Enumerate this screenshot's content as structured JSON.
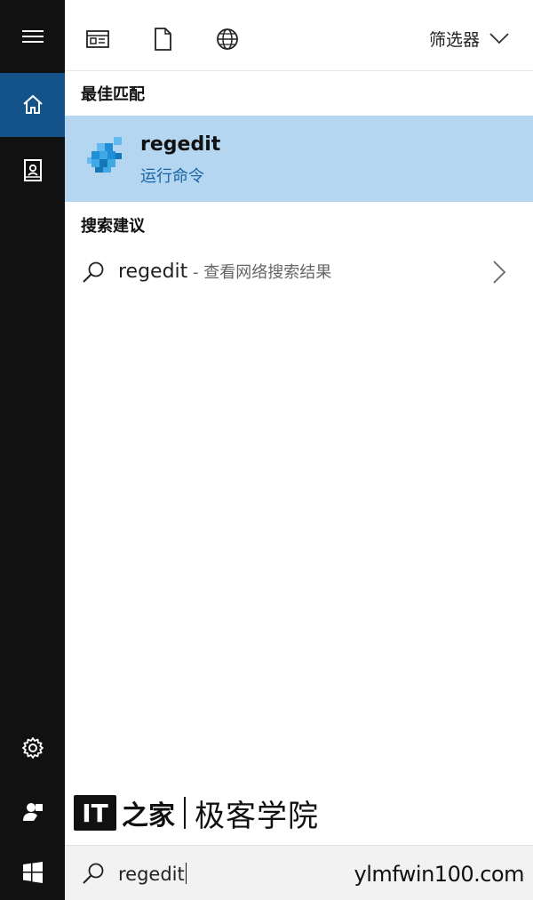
{
  "toolbar": {
    "icons": [
      "app-panel-icon",
      "document-icon",
      "globe-icon"
    ],
    "filter_label": "筛选器"
  },
  "rail": {
    "items": [
      "menu-icon",
      "home-icon",
      "notebook-icon",
      "settings-icon",
      "person-icon",
      "windows-start-icon"
    ],
    "active": "home-icon"
  },
  "best_match": {
    "heading": "最佳匹配",
    "title": "regedit",
    "subtitle": "运行命令",
    "icon": "regedit-cube-icon"
  },
  "suggestions": {
    "heading": "搜索建议",
    "items": [
      {
        "text": "regedit",
        "suffix": " - 查看网络搜索结果"
      }
    ]
  },
  "watermark": {
    "logo_text": "IT",
    "logo_mark": "之家",
    "text": "极客学院"
  },
  "search": {
    "value": "regedit",
    "site": "ylmfwin100.com"
  },
  "colors": {
    "rail_bg": "#111111",
    "rail_active": "#14538a",
    "best_match_bg": "#b4d6f0",
    "link_blue": "#1b64a8"
  }
}
